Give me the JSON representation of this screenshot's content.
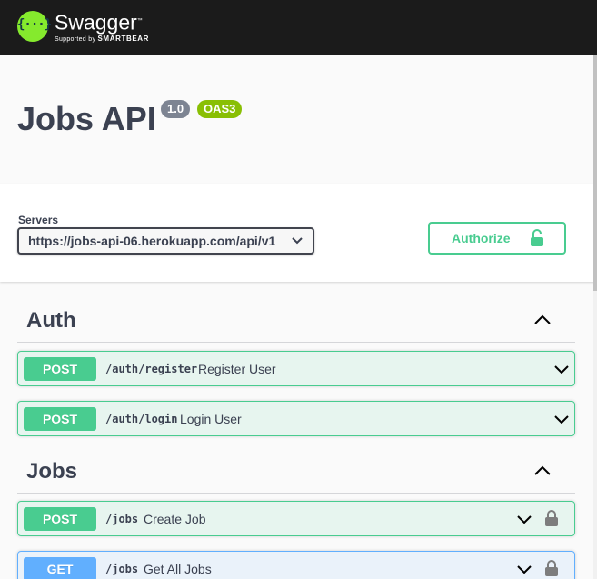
{
  "header": {
    "logo_symbol": "{···}",
    "brand": "Swagger",
    "brand_tm": "™",
    "tagline_prefix": "Supported by",
    "tagline_brand": "SMARTBEAR",
    "logo_color": "#85ea2d",
    "bar_color": "#1b1b1b"
  },
  "info": {
    "title": "Jobs API",
    "version": "1.0",
    "oas": "OAS3"
  },
  "servers": {
    "label": "Servers",
    "selected": "https://jobs-api-06.herokuapp.com/api/v1"
  },
  "authorize": {
    "label": "Authorize",
    "icon": "unlocked-padlock-icon",
    "color": "#49cc90"
  },
  "tags": [
    {
      "name": "Auth",
      "expanded": true,
      "operations": [
        {
          "method": "POST",
          "path": "/auth/register",
          "summary": "Register User",
          "locked": false
        },
        {
          "method": "POST",
          "path": "/auth/login",
          "summary": "Login User",
          "locked": false
        }
      ]
    },
    {
      "name": "Jobs",
      "expanded": true,
      "operations": [
        {
          "method": "POST",
          "path": "/jobs",
          "summary": "Create Job",
          "locked": true
        },
        {
          "method": "GET",
          "path": "/jobs",
          "summary": "Get All Jobs",
          "locked": true
        }
      ]
    }
  ],
  "colors": {
    "post": "#49cc90",
    "get": "#61affe",
    "text": "#3b4151"
  }
}
